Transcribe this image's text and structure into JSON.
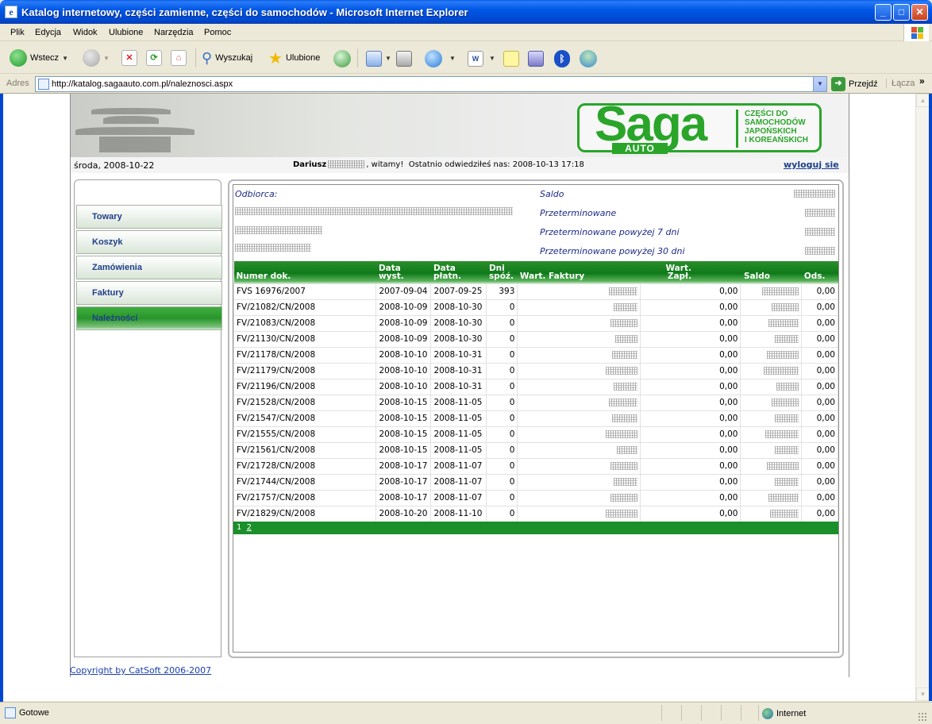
{
  "window": {
    "title": "Katalog internetowy, części zamienne, części do samochodów - Microsoft Internet Explorer",
    "buttons": {
      "minimize": "_",
      "maximize": "□",
      "close": "✕"
    }
  },
  "menu": [
    "Plik",
    "Edycja",
    "Widok",
    "Ulubione",
    "Narzędzia",
    "Pomoc"
  ],
  "toolbar": {
    "back": "Wstecz",
    "search": "Wyszukaj",
    "favorites": "Ulubione"
  },
  "address": {
    "label": "Adres",
    "url": "http://katalog.sagaauto.com.pl/naleznosci.aspx",
    "go": "Przejdź",
    "links": "Łącza",
    "more": "»"
  },
  "header": {
    "logo_text": "Saga",
    "logo_sub": "AUTO",
    "logo_tagline": [
      "CZĘŚCI DO",
      "SAMOCHODÓW",
      "JAPOŃSKICH",
      "I KOREAŃSKICH"
    ],
    "date": "środa, 2008-10-22",
    "user_name": "Dariusz",
    "welcome": ", witamy!",
    "last_visit": "Ostatnio odwiedziłeś nas: 2008-10-13 17:18",
    "logout": "wyloguj sie"
  },
  "nav": [
    {
      "label": "Towary",
      "active": false
    },
    {
      "label": "Koszyk",
      "active": false
    },
    {
      "label": "Zamówienia",
      "active": false
    },
    {
      "label": "Faktury",
      "active": false
    },
    {
      "label": "Należności",
      "active": true
    }
  ],
  "customer": {
    "recipient_label": "Odbiorca:",
    "saldo_label": "Saldo",
    "overdue_label": "Przeterminowane",
    "overdue7_label": "Przeterminowane powyżej 7 dni",
    "overdue30_label": "Przeterminowane powyżej 30 dni"
  },
  "table": {
    "columns": [
      "Numer dok.",
      "Data wyst.",
      "Data płatn.",
      "Dni spóź.",
      "Wart. Faktury",
      "Wart. Zapł.",
      "Saldo",
      "Ods."
    ],
    "rows": [
      [
        "FVS 16976/2007",
        "2007-09-04",
        "2007-09-25",
        "393",
        "",
        "0,00",
        "",
        "0,00"
      ],
      [
        "FV/21082/CN/2008",
        "2008-10-09",
        "2008-10-30",
        "0",
        "",
        "0,00",
        "",
        "0,00"
      ],
      [
        "FV/21083/CN/2008",
        "2008-10-09",
        "2008-10-30",
        "0",
        "",
        "0,00",
        "",
        "0,00"
      ],
      [
        "FV/21130/CN/2008",
        "2008-10-09",
        "2008-10-30",
        "0",
        "",
        "0,00",
        "",
        "0,00"
      ],
      [
        "FV/21178/CN/2008",
        "2008-10-10",
        "2008-10-31",
        "0",
        "",
        "0,00",
        "",
        "0,00"
      ],
      [
        "FV/21179/CN/2008",
        "2008-10-10",
        "2008-10-31",
        "0",
        "",
        "0,00",
        "",
        "0,00"
      ],
      [
        "FV/21196/CN/2008",
        "2008-10-10",
        "2008-10-31",
        "0",
        "",
        "0,00",
        "",
        "0,00"
      ],
      [
        "FV/21528/CN/2008",
        "2008-10-15",
        "2008-11-05",
        "0",
        "",
        "0,00",
        "",
        "0,00"
      ],
      [
        "FV/21547/CN/2008",
        "2008-10-15",
        "2008-11-05",
        "0",
        "",
        "0,00",
        "",
        "0,00"
      ],
      [
        "FV/21555/CN/2008",
        "2008-10-15",
        "2008-11-05",
        "0",
        "",
        "0,00",
        "",
        "0,00"
      ],
      [
        "FV/21561/CN/2008",
        "2008-10-15",
        "2008-11-05",
        "0",
        "",
        "0,00",
        "",
        "0,00"
      ],
      [
        "FV/21728/CN/2008",
        "2008-10-17",
        "2008-11-07",
        "0",
        "",
        "0,00",
        "",
        "0,00"
      ],
      [
        "FV/21744/CN/2008",
        "2008-10-17",
        "2008-11-07",
        "0",
        "",
        "0,00",
        "",
        "0,00"
      ],
      [
        "FV/21757/CN/2008",
        "2008-10-17",
        "2008-11-07",
        "0",
        "",
        "0,00",
        "",
        "0,00"
      ],
      [
        "FV/21829/CN/2008",
        "2008-10-20",
        "2008-11-10",
        "0",
        "",
        "0,00",
        "",
        "0,00"
      ]
    ],
    "pages": [
      "1",
      "2"
    ]
  },
  "footer": {
    "copyright": "Copyright by CatSoft 2006-2007"
  },
  "status": {
    "text": "Gotowe",
    "zone": "Internet"
  }
}
